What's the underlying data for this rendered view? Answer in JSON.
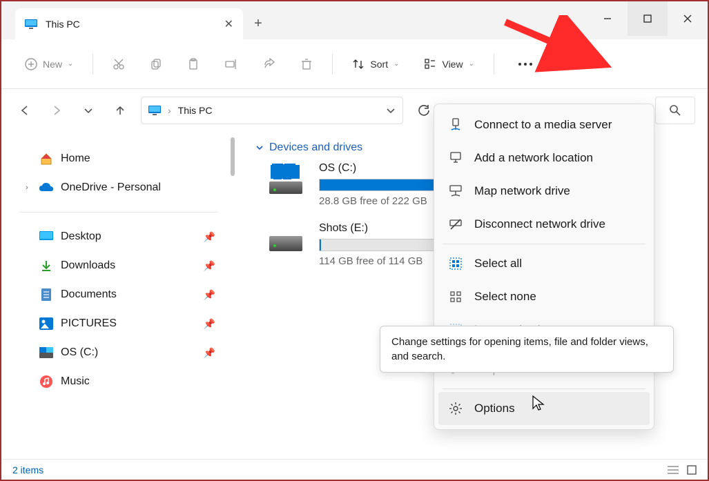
{
  "tab": {
    "title": "This PC"
  },
  "toolbar": {
    "new": "New",
    "sort": "Sort",
    "view": "View"
  },
  "breadcrumb": {
    "location": "This PC"
  },
  "sidebar": {
    "home": "Home",
    "onedrive": "OneDrive - Personal",
    "quick": [
      {
        "label": "Desktop"
      },
      {
        "label": "Downloads"
      },
      {
        "label": "Documents"
      },
      {
        "label": "PICTURES"
      },
      {
        "label": "OS (C:)"
      },
      {
        "label": "Music"
      }
    ]
  },
  "content": {
    "group": "Devices and drives",
    "drives": [
      {
        "name": "OS (C:)",
        "free": "28.8 GB free of 222 GB",
        "fill": 87
      },
      {
        "name": "Shots (E:)",
        "free": "114 GB free of 114 GB",
        "fill": 1
      }
    ]
  },
  "menu": {
    "items": [
      "Connect to a media server",
      "Add a network location",
      "Map network drive",
      "Disconnect network drive"
    ],
    "select": [
      "Select all",
      "Select none",
      "Invert selection"
    ],
    "props": "Properties",
    "options": "Options"
  },
  "tooltip": "Change settings for opening items, file and folder views, and search.",
  "status": {
    "count": "2 items"
  }
}
